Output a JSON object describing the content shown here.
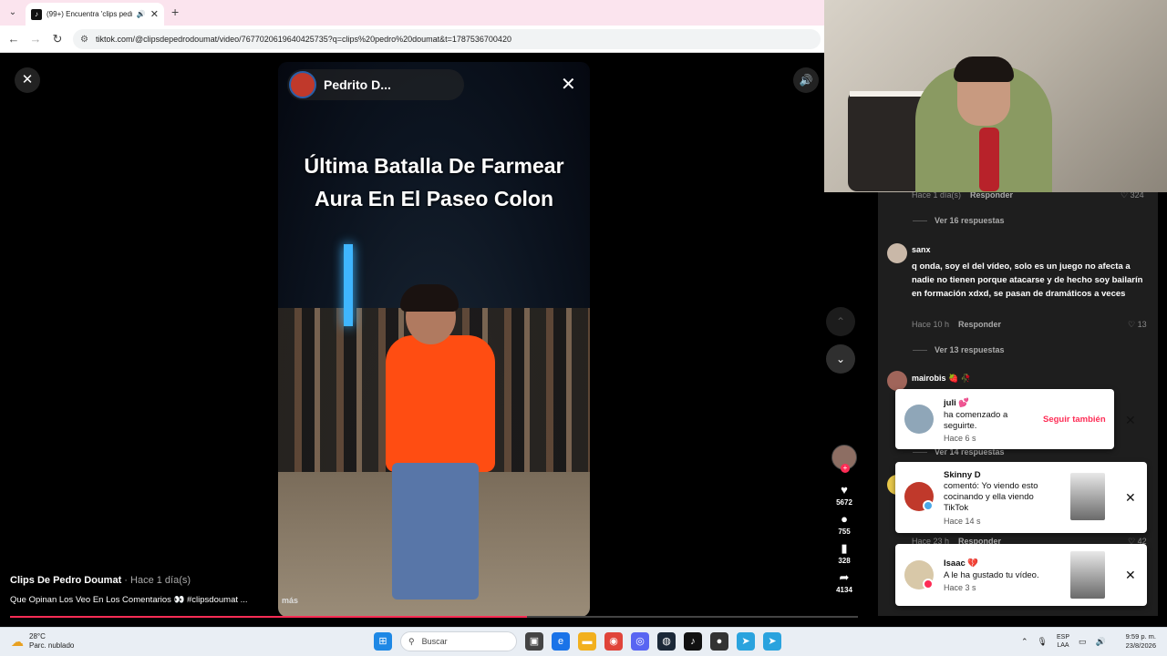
{
  "browser": {
    "tab_title": "(99+) Encuentra 'clips pedro...",
    "new_tab_label": "+",
    "url": "tiktok.com/@clipsdepedrodoumat/video/7677020619640425735?q=clips%20pedro%20doumat&t=1787536700420"
  },
  "video": {
    "header_name": "Pedrito D...",
    "overlay_title": "Última Batalla De Farmear\nAura En El Paseo Colon",
    "author": "Clips De Pedro Doumat",
    "author_time": " · Hace 1 día(s)",
    "description": "Que Opinan Los Veo En Los Comentarios 👀 #clipsdoumat ...",
    "more_label": "más",
    "progress_fraction": 0.61,
    "likes": "5672",
    "comments_count": "755",
    "saves": "328",
    "shares": "4134"
  },
  "comments": {
    "top_meta_time": "Hace 1 día(s)",
    "reply_label": "Responder",
    "top_likes": "324",
    "view_replies_1": "Ver 16 respuestas",
    "c1_user": "sanx",
    "c1_text": "q onda, soy el del vídeo, solo es un juego no afecta a nadie no tienen porque atacarse y de hecho soy bailarín en formación xdxd, se pasan de dramáticos a veces",
    "c1_time": "Hace 10 h",
    "c1_likes": "13",
    "view_replies_2": "Ver 13 respuestas",
    "c2_user": "mairobis 🍓 🥀",
    "view_replies_3": "Ver 14 respuestas",
    "c3_time": "Hace 23 h",
    "c3_likes": "42"
  },
  "notifications": [
    {
      "who": "juli 💕",
      "msg": "ha comenzado a seguirte.",
      "when": "Hace 6 s",
      "action": "Seguir también"
    },
    {
      "who": "Skinny D",
      "msg": "comentó: Yo viendo esto cocinando y ella viendo TikTok",
      "when": "Hace 14 s"
    },
    {
      "who": "Isaac 💔",
      "msg": "A le ha gustado tu vídeo.",
      "when": "Hace 3 s"
    }
  ],
  "taskbar": {
    "temp": "28°C",
    "weather_desc": "Parc. nublado",
    "search_placeholder": "Buscar",
    "lang_1": "ESP",
    "lang_2": "LAA",
    "time": "9:59 p. m.",
    "date": "23/8/2026"
  },
  "colors": {
    "accent": "#fe2c55",
    "tab_strip": "#fbe4ee"
  },
  "icons": [
    "tab-dropdown-icon",
    "tiktok-favicon-icon",
    "speaker-icon",
    "close-icon",
    "back-icon",
    "forward-icon",
    "reload-icon",
    "site-settings-icon",
    "volume-icon",
    "chevron-up-icon",
    "chevron-down-icon",
    "heart-icon",
    "comment-icon",
    "bookmark-icon",
    "share-icon",
    "windows-start-icon",
    "search-icon"
  ]
}
